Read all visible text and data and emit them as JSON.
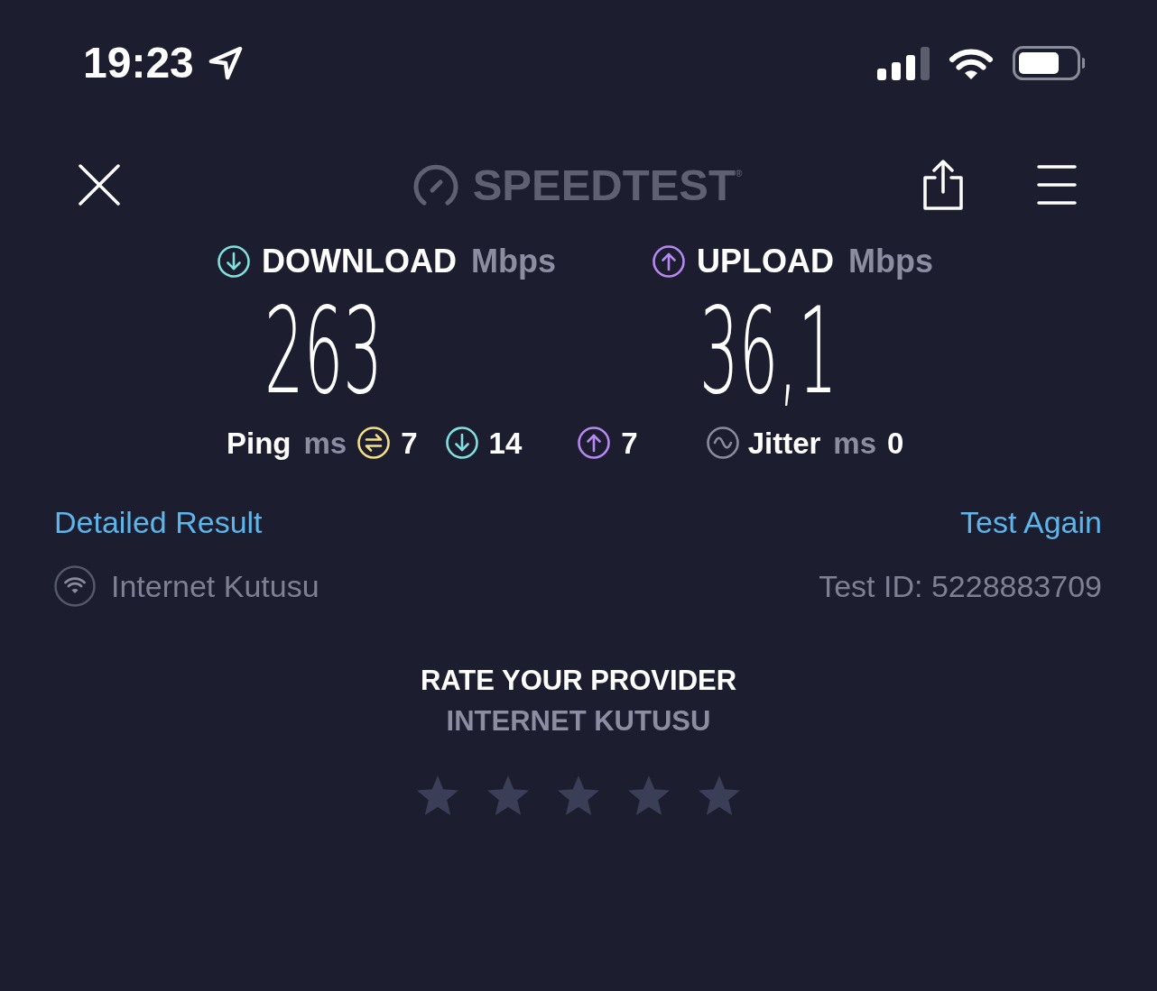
{
  "status_bar": {
    "time": "19:23"
  },
  "header": {
    "logo": "SPEEDTEST$^{®}$"
  },
  "results": [
    {
      "kind": "download",
      "label": "DOWNLOAD",
      "unit": "Mbps",
      "value": "263"
    },
    {
      "kind": "upload",
      "label": "UPLOAD",
      "unit": "Mbps",
      "value": "36,1"
    }
  ],
  "ping": {
    "label": "Ping",
    "unit": "ms",
    "readings": [
      {
        "kind": "idle",
        "value": "7"
      },
      {
        "kind": "download",
        "value": "14"
      },
      {
        "kind": "upload",
        "value": "7"
      }
    ]
  },
  "jitter": {
    "label": "Jitter",
    "unit": "ms",
    "value": "0"
  },
  "links": [
    {
      "label": "Detailed Result"
    },
    {
      "label": "Test Again"
    }
  ],
  "connection": {
    "provider": "Internet Kutusu",
    "test_id": "Test ID: 5228883709"
  },
  "rating": {
    "title": "RATE YOUR PROVIDER",
    "provider": "INTERNET KUTUSU"
  }
}
